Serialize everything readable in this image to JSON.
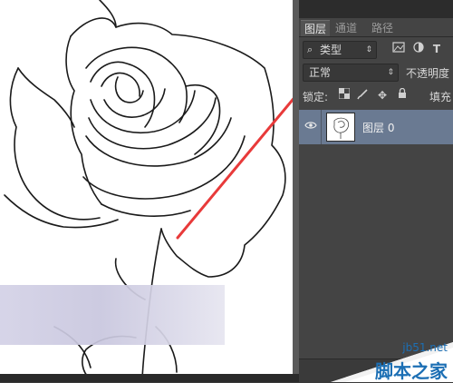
{
  "panel": {
    "tabs": [
      {
        "label": "图层",
        "active": true
      },
      {
        "label": "通道",
        "active": false
      },
      {
        "label": "路径",
        "active": false
      }
    ],
    "filter": {
      "icon": "search-icon",
      "value": "类型"
    },
    "blend_mode": "正常",
    "opacity_label": "不透明度",
    "lock_label": "锁定:",
    "fill_label": "填充",
    "layers": [
      {
        "name": "图层 0",
        "visible": true,
        "selected": true
      }
    ]
  },
  "watermark": {
    "line1": "jb51.net",
    "line2": "脚本之家"
  },
  "colors": {
    "panel_bg": "#444444",
    "selected_layer": "#6a7a92",
    "arrow": "#e83a3a",
    "watermark": "#1c6fb4"
  }
}
